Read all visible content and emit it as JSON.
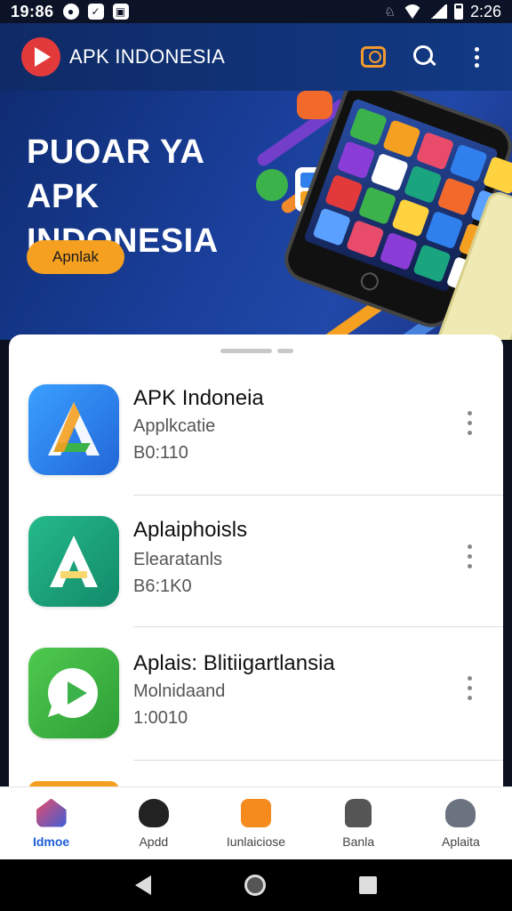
{
  "status_bar": {
    "time_left": "19:86",
    "time_right": "2:26"
  },
  "app_bar": {
    "title": "APK INDONESIA"
  },
  "hero": {
    "title": "PUOAR YA APK INDONESIA",
    "button_label": "Apnlak"
  },
  "apps": [
    {
      "name": "APK Indoneia",
      "category": "Applkcatie",
      "size": "B0:110",
      "icon_color": "#2f80ed",
      "icon": "a-logo-icon"
    },
    {
      "name": "Aplaiphoisls",
      "category": "Elearatanls",
      "size": "B6:1K0",
      "icon_color": "#1aa57f",
      "icon": "a-letter-icon"
    },
    {
      "name": "Aplais: Blitiigartlansia",
      "category": "Molnidaand",
      "size": "1:0010",
      "icon_color": "#3cb34a",
      "icon": "play-icon"
    }
  ],
  "bottom_nav": [
    {
      "label": "Idmoe",
      "active": true,
      "icon": "home-icon"
    },
    {
      "label": "Apdd",
      "active": false,
      "icon": "apps-icon"
    },
    {
      "label": "Iunlaiciose",
      "active": false,
      "icon": "download-icon"
    },
    {
      "label": "Banla",
      "active": false,
      "icon": "lock-icon"
    },
    {
      "label": "Aplaita",
      "active": false,
      "icon": "profile-icon"
    }
  ]
}
